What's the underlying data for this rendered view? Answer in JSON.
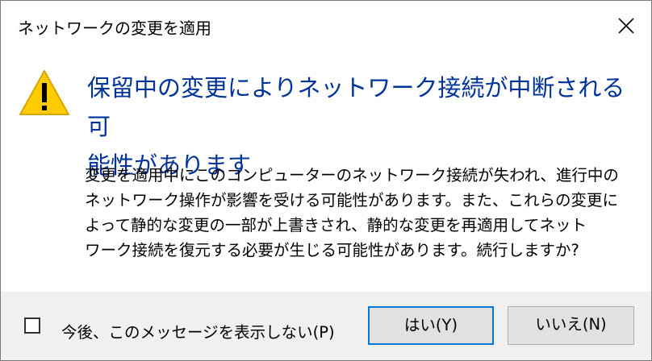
{
  "window": {
    "title": "ネットワークの変更を適用",
    "close_icon": "close-icon"
  },
  "main": {
    "icon": "warning-icon",
    "instruction_line1": "保留中の変更によりネットワーク接続が中断される可",
    "instruction_line2": "能性があります",
    "content_lines": [
      "変更を適用中にこのコンピューターのネットワーク接続が失われ、進行中の",
      "ネットワーク操作が影響を受ける可能性があります。また、これらの変更に",
      "よって静的な変更の一部が上書きされ、静的な変更を再適用してネット",
      "ワーク接続を復元する必要が生じる可能性があります。続行しますか?"
    ]
  },
  "footer": {
    "checkbox_label": "今後、このメッセージを表示しない(P)",
    "checkbox_checked": false,
    "yes_label": "はい(Y)",
    "no_label": "いいえ(N)"
  },
  "colors": {
    "instruction": "#003399",
    "footer_bg": "#f0f0f0",
    "default_button_border": "#0078d7",
    "warning_fill": "#ffcc00"
  }
}
